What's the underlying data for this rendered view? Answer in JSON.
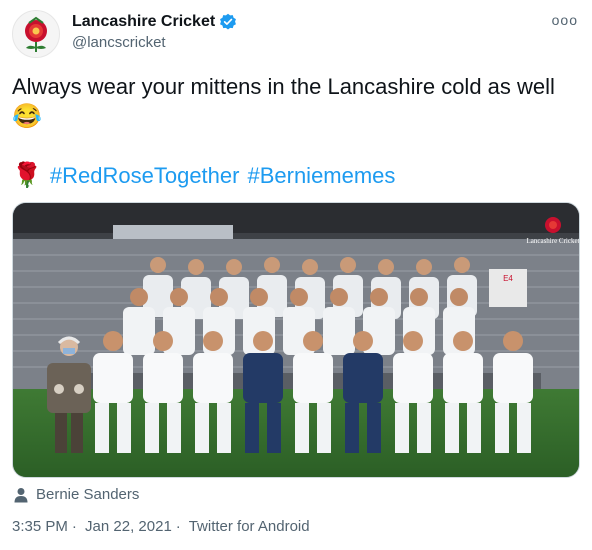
{
  "tweet": {
    "display_name": "Lancashire Cricket",
    "handle": "@lancscricket",
    "more_label": "ooo",
    "text": "Always wear your mittens in the Lancashire cold as well",
    "text_emoji": "😂",
    "rose_emoji": "🌹",
    "hashtags": [
      "#RedRoseTogether",
      "#Berniememes"
    ],
    "tagged_person": "Bernie Sanders",
    "time": "3:35 PM",
    "date": "Jan 22, 2021",
    "source": "Twitter for Android",
    "separator": "·"
  },
  "photo": {
    "logo_text": "Lancashire Cricket",
    "scoreboard_text": "E4"
  },
  "colors": {
    "link": "#1d9bf0",
    "verified": "#1d9bf0",
    "secondary_text": "#536471",
    "rose_red": "#c8102e"
  },
  "icons": [
    "rose-crest-icon",
    "verified-badge-icon",
    "more-options-icon",
    "person-tag-icon"
  ]
}
